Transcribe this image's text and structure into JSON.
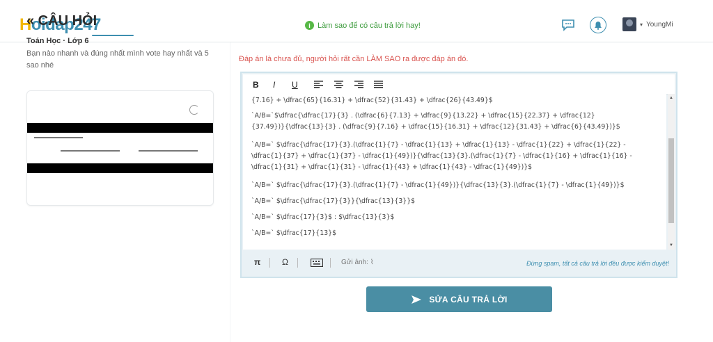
{
  "header": {
    "logo": {
      "first": "H",
      "rest": "oidap247"
    },
    "tip": "Làm sao để có câu trả lời hay!",
    "username": "YoungMi"
  },
  "question": {
    "title": "« CÂU HỎI",
    "subject": "Toán Học · Lớp 6",
    "text": "Bạn nào nhanh và đúng nhất mình vote hay nhất và 5 sao nhé"
  },
  "answer": {
    "warning": "Đáp án là chưa đủ, người hỏi rất cần LÀM SAO ra được đáp án đó.",
    "toolbar": {
      "bold": "B",
      "italic": "I",
      "underline": "U"
    },
    "lines": [
      "{7.16} + \\dfrac{65}{16.31} + \\dfrac{52}{31.43} + \\dfrac{26}{43.49}$",
      "`A/B=`$\\dfrac{\\dfrac{17}{3} . (\\dfrac{6}{7.13} + \\dfrac{9}{13.22} + \\dfrac{15}{22.37} + \\dfrac{12}",
      "{37.49})}{\\dfrac{13}{3} . (\\dfrac{9}{7.16} + \\dfrac{15}{16.31} + \\dfrac{12}{31.43} + \\dfrac{6}{43.49})}$",
      "`A/B=` $\\dfrac{\\dfrac{17}{3}.(\\dfrac{1}{7} - \\dfrac{1}{13} + \\dfrac{1}{13} - \\dfrac{1}{22} + \\dfrac{1}{22} -",
      "\\dfrac{1}{37} + \\dfrac{1}{37} - \\dfrac{1}{49})}{\\dfrac{13}{3}.(\\dfrac{1}{7} - \\dfrac{1}{16} + \\dfrac{1}{16} -",
      "\\dfrac{1}{31} + \\dfrac{1}{31} - \\dfrac{1}{43} + \\dfrac{1}{43} - \\dfrac{1}{49})}$",
      "`A/B=` $\\dfrac{\\dfrac{17}{3}.(\\dfrac{1}{7} - \\dfrac{1}{49})}{\\dfrac{13}{3}.(\\dfrac{1}{7} - \\dfrac{1}{49})}$",
      "`A/B=` $\\dfrac{\\dfrac{17}{3}}{\\dfrac{13}{3}}$",
      "`A/B=` $\\dfrac{17}{3}$ : $\\dfrac{13}{3}$",
      "`A/B=` $\\dfrac{17}{13}$"
    ],
    "bottom": {
      "pi": "π",
      "omega": "Ω",
      "send_image": "Gửi ảnh:",
      "spam_note": "Đừng spam, tất cả câu trả lời đều được kiểm duyệt!"
    },
    "submit_label": "SỬA CÂU TRẢ LỜI"
  },
  "colors": {
    "accent": "#4a8ea4",
    "logo_yellow": "#f2b705",
    "warning": "#d9534f",
    "tip_green": "#3a9a3a"
  }
}
